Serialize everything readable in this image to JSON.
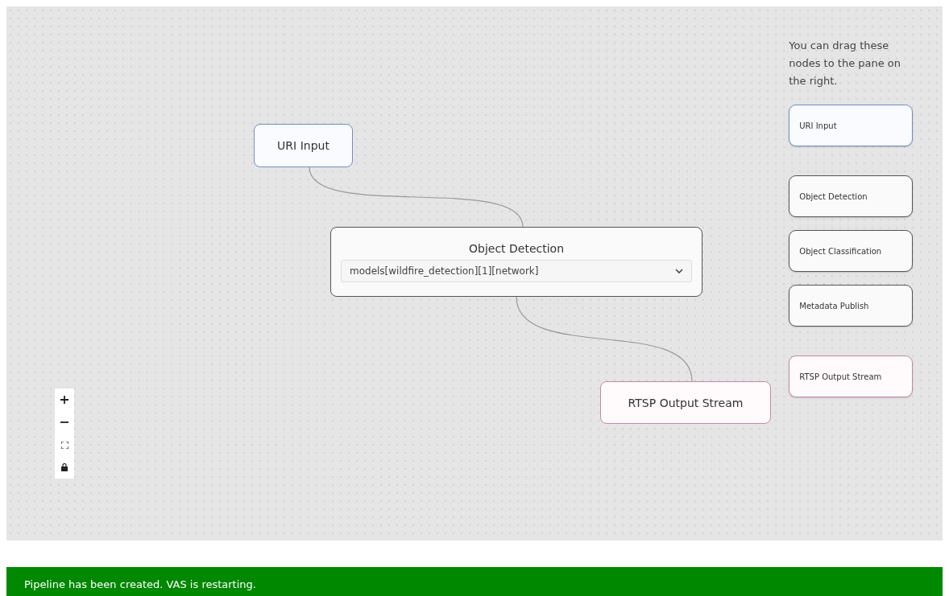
{
  "canvas": {
    "nodes": [
      {
        "kind": "input",
        "label": "URI Input"
      },
      {
        "kind": "process",
        "label": "Object Detection",
        "select": {
          "value": "models[wildfire_detection][1][network]"
        }
      },
      {
        "kind": "output",
        "label": "RTSP Output Stream"
      }
    ]
  },
  "palette": {
    "hint": "You can drag these nodes to the pane on the right.",
    "items": [
      {
        "kind": "input",
        "label": "URI Input"
      },
      {
        "kind": "process",
        "label": "Object Detection"
      },
      {
        "kind": "process",
        "label": "Object Classification"
      },
      {
        "kind": "process",
        "label": "Metadata Publish"
      },
      {
        "kind": "output",
        "label": "RTSP Output Stream"
      }
    ]
  },
  "banner": {
    "message": "Pipeline has been created. VAS is restarting."
  }
}
